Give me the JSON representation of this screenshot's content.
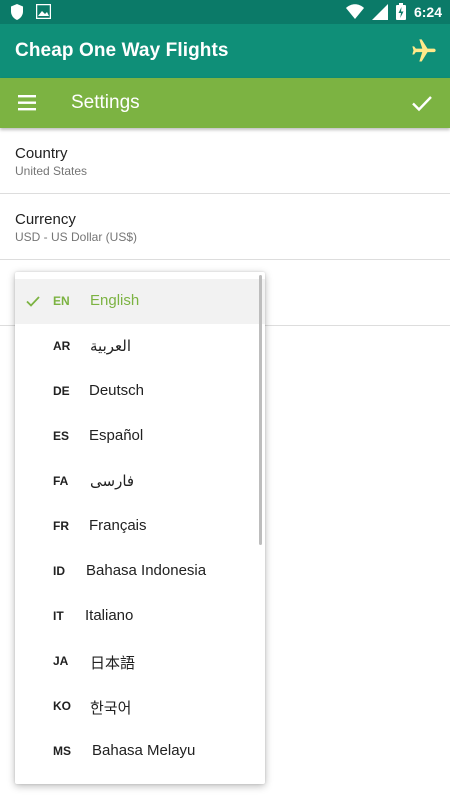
{
  "status_bar": {
    "time": "6:24"
  },
  "app_bar": {
    "title": "Cheap One Way Flights"
  },
  "toolbar": {
    "title": "Settings"
  },
  "settings": [
    {
      "label": "Country",
      "value": "United States"
    },
    {
      "label": "Currency",
      "value": "USD - US Dollar (US$)"
    }
  ],
  "languages": [
    {
      "code": "EN",
      "name": "English",
      "selected": true
    },
    {
      "code": "AR",
      "name": "العربية"
    },
    {
      "code": "DE",
      "name": "Deutsch"
    },
    {
      "code": "ES",
      "name": "Español"
    },
    {
      "code": "FA",
      "name": "فارسی"
    },
    {
      "code": "FR",
      "name": "Français"
    },
    {
      "code": "ID",
      "name": "Bahasa Indonesia"
    },
    {
      "code": "IT",
      "name": "Italiano"
    },
    {
      "code": "JA",
      "name": "日本語"
    },
    {
      "code": "KO",
      "name": "한국어"
    },
    {
      "code": "MS",
      "name": "Bahasa Melayu"
    }
  ],
  "colors": {
    "primary_dark": "#0b7a68",
    "primary": "#0f8f78",
    "accent": "#7cb342"
  },
  "icons": [
    "shield-icon",
    "image-icon",
    "wifi-icon",
    "signal-icon",
    "battery-icon",
    "airplane-icon",
    "menu-icon",
    "check-icon"
  ]
}
